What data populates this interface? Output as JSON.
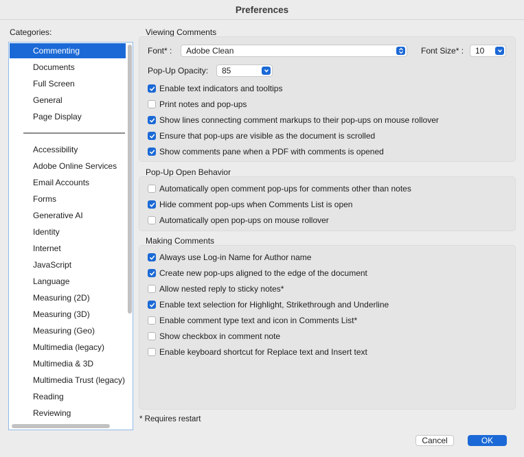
{
  "window": {
    "title": "Preferences"
  },
  "sidebar": {
    "label": "Categories:",
    "items_top": [
      "Commenting",
      "Documents",
      "Full Screen",
      "General",
      "Page Display"
    ],
    "items_bottom": [
      "Accessibility",
      "Adobe Online Services",
      "Email Accounts",
      "Forms",
      "Generative AI",
      "Identity",
      "Internet",
      "JavaScript",
      "Language",
      "Measuring (2D)",
      "Measuring (3D)",
      "Measuring (Geo)",
      "Multimedia (legacy)",
      "Multimedia & 3D",
      "Multimedia Trust (legacy)",
      "Reading",
      "Reviewing"
    ],
    "selected": "Commenting"
  },
  "viewing": {
    "title": "Viewing Comments",
    "font_label": "Font* :",
    "font_value": "Adobe Clean",
    "font_size_label": "Font Size* :",
    "font_size_value": "10",
    "opacity_label": "Pop-Up Opacity:",
    "opacity_value": "85",
    "options": [
      {
        "label": "Enable text indicators and tooltips",
        "checked": true
      },
      {
        "label": "Print notes and pop-ups",
        "checked": false
      },
      {
        "label": "Show lines connecting comment markups to their pop-ups on mouse rollover",
        "checked": true
      },
      {
        "label": "Ensure that pop-ups are visible as the document is scrolled",
        "checked": true
      },
      {
        "label": "Show comments pane when a PDF with comments is opened",
        "checked": true
      }
    ]
  },
  "popup": {
    "title": "Pop-Up Open Behavior",
    "options": [
      {
        "label": "Automatically open comment pop-ups for comments other than notes",
        "checked": false
      },
      {
        "label": "Hide comment pop-ups when Comments List is open",
        "checked": true
      },
      {
        "label": "Automatically open pop-ups on mouse rollover",
        "checked": false
      }
    ]
  },
  "making": {
    "title": "Making Comments",
    "options": [
      {
        "label": "Always use Log-in Name for Author name",
        "checked": true
      },
      {
        "label": "Create new pop-ups aligned to the edge of the document",
        "checked": true
      },
      {
        "label": "Allow nested reply to sticky notes*",
        "checked": false
      },
      {
        "label": "Enable text selection for Highlight, Strikethrough and Underline",
        "checked": true
      },
      {
        "label": "Enable comment type text and icon in Comments List*",
        "checked": false
      },
      {
        "label": "Show checkbox in comment note",
        "checked": false
      },
      {
        "label": "Enable keyboard shortcut for Replace text and Insert text",
        "checked": false
      }
    ]
  },
  "footer": {
    "note": "* Requires restart",
    "cancel_label": "Cancel",
    "ok_label": "OK"
  },
  "colors": {
    "accent": "#1b69d6",
    "background": "#ececec",
    "group": "#e5e5e5"
  }
}
